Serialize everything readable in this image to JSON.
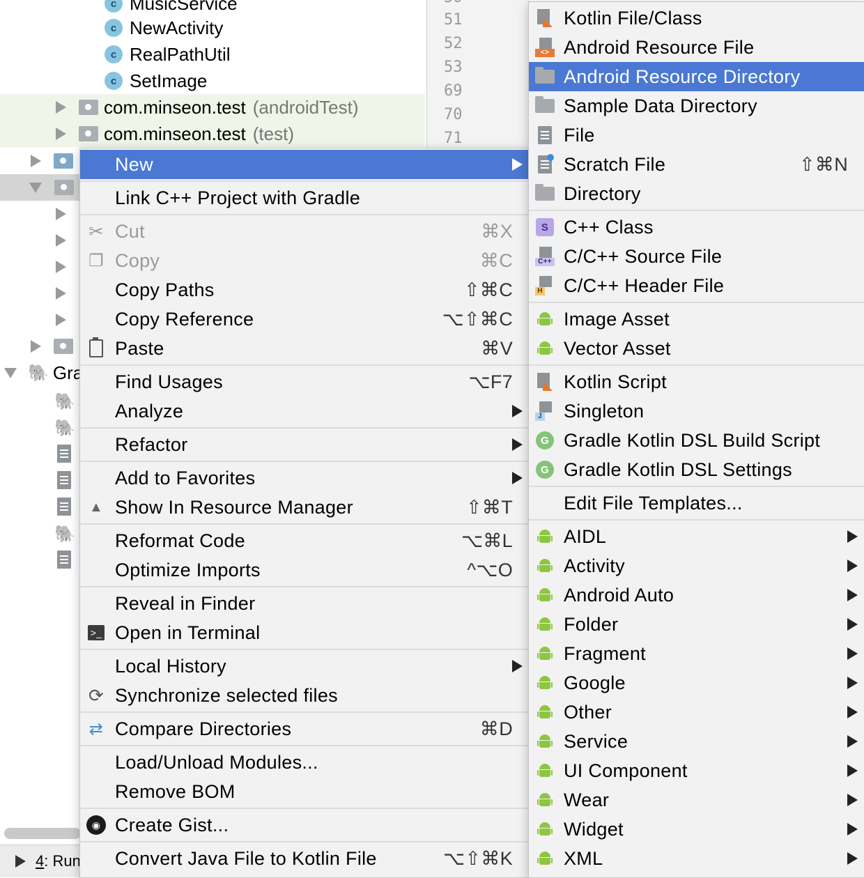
{
  "tree": {
    "classes": [
      "MusicService",
      "NewActivity",
      "RealPathUtil",
      "SetImage"
    ],
    "class_badge": "c",
    "packages": [
      {
        "name": "com.minseon.test",
        "suffix": "(androidTest)"
      },
      {
        "name": "com.minseon.test",
        "suffix": "(test)"
      }
    ],
    "gradle_label": "Gra"
  },
  "gutter": {
    "lines": [
      "51",
      "52",
      "53",
      "69",
      "70",
      "71"
    ]
  },
  "runbar": {
    "number": "4",
    "label": ": Run"
  },
  "context_menu": {
    "items": [
      {
        "name": "new",
        "label": "New",
        "shortcut": "",
        "submenu": true,
        "selected": true,
        "icon": ""
      },
      {
        "sep": true
      },
      {
        "name": "link-cpp",
        "label": "Link C++ Project with Gradle",
        "shortcut": "",
        "icon": ""
      },
      {
        "sep": true
      },
      {
        "name": "cut",
        "label": "Cut",
        "shortcut": "⌘X",
        "disabled": true,
        "icon": "scissors-icon"
      },
      {
        "name": "copy",
        "label": "Copy",
        "shortcut": "⌘C",
        "disabled": true,
        "icon": "copy-icon"
      },
      {
        "name": "copy-paths",
        "label": "Copy Paths",
        "shortcut": "⇧⌘C",
        "icon": ""
      },
      {
        "name": "copy-reference",
        "label": "Copy Reference",
        "shortcut": "⌥⇧⌘C",
        "icon": ""
      },
      {
        "name": "paste",
        "label": "Paste",
        "shortcut": "⌘V",
        "icon": "clipboard-icon"
      },
      {
        "sep": true
      },
      {
        "name": "find-usages",
        "label": "Find Usages",
        "shortcut": "⌥F7",
        "icon": ""
      },
      {
        "name": "analyze",
        "label": "Analyze",
        "submenu": true,
        "icon": ""
      },
      {
        "sep": true
      },
      {
        "name": "refactor",
        "label": "Refactor",
        "submenu": true,
        "icon": ""
      },
      {
        "sep": true
      },
      {
        "name": "add-favorites",
        "label": "Add to Favorites",
        "submenu": true,
        "icon": ""
      },
      {
        "name": "show-resource-manager",
        "label": "Show In Resource Manager",
        "shortcut": "⇧⌘T",
        "icon": "shapes-icon"
      },
      {
        "sep": true
      },
      {
        "name": "reformat",
        "label": "Reformat Code",
        "shortcut": "⌥⌘L",
        "icon": ""
      },
      {
        "name": "optimize-imports",
        "label": "Optimize Imports",
        "shortcut": "^⌥O",
        "icon": ""
      },
      {
        "sep": true
      },
      {
        "name": "reveal-finder",
        "label": "Reveal in Finder",
        "shortcut": "",
        "icon": ""
      },
      {
        "name": "open-terminal",
        "label": "Open in Terminal",
        "shortcut": "",
        "icon": "terminal-icon"
      },
      {
        "sep": true
      },
      {
        "name": "local-history",
        "label": "Local History",
        "submenu": true,
        "icon": ""
      },
      {
        "name": "synchronize",
        "label": "Synchronize selected files",
        "shortcut": "",
        "icon": "sync-icon"
      },
      {
        "sep": true
      },
      {
        "name": "compare-dirs",
        "label": "Compare Directories",
        "shortcut": "⌘D",
        "icon": "compare-icon"
      },
      {
        "sep": true
      },
      {
        "name": "load-unload",
        "label": "Load/Unload Modules...",
        "shortcut": "",
        "icon": ""
      },
      {
        "name": "remove-bom",
        "label": "Remove BOM",
        "shortcut": "",
        "icon": ""
      },
      {
        "sep": true
      },
      {
        "name": "create-gist",
        "label": "Create Gist...",
        "shortcut": "",
        "icon": "github-icon"
      },
      {
        "sep": true
      },
      {
        "name": "convert-kotlin",
        "label": "Convert Java File to Kotlin File",
        "shortcut": "⌥⇧⌘K",
        "icon": ""
      }
    ]
  },
  "new_submenu": {
    "items": [
      {
        "name": "kotlin-file",
        "label": "Kotlin File/Class",
        "icon": "kotlin-icon"
      },
      {
        "name": "android-resource-file",
        "label": "Android Resource File",
        "icon": "resource-file-icon"
      },
      {
        "name": "android-resource-dir",
        "label": "Android Resource Directory",
        "icon": "folder-icon",
        "selected": true
      },
      {
        "name": "sample-data-dir",
        "label": "Sample Data Directory",
        "icon": "folder-icon"
      },
      {
        "name": "file",
        "label": "File",
        "icon": "file-icon"
      },
      {
        "name": "scratch-file",
        "label": "Scratch File",
        "shortcut": "⇧⌘N",
        "icon": "scratch-icon"
      },
      {
        "name": "directory",
        "label": "Directory",
        "icon": "folder-icon"
      },
      {
        "sep": true
      },
      {
        "name": "cpp-class",
        "label": "C++ Class",
        "icon": "s-badge-icon",
        "badge": "S"
      },
      {
        "name": "cpp-source",
        "label": "C/C++ Source File",
        "icon": "cpp-icon",
        "badge": "C++"
      },
      {
        "name": "cpp-header",
        "label": "C/C++ Header File",
        "icon": "header-icon",
        "badge": "H"
      },
      {
        "sep": true
      },
      {
        "name": "image-asset",
        "label": "Image Asset",
        "icon": "android-icon"
      },
      {
        "name": "vector-asset",
        "label": "Vector Asset",
        "icon": "android-icon"
      },
      {
        "sep": true
      },
      {
        "name": "kotlin-script",
        "label": "Kotlin Script",
        "icon": "kotlin-icon"
      },
      {
        "name": "singleton",
        "label": "Singleton",
        "icon": "java-icon",
        "badge": "J"
      },
      {
        "name": "gradle-kts-build",
        "label": "Gradle Kotlin DSL Build Script",
        "icon": "g-badge-icon",
        "badge": "G"
      },
      {
        "name": "gradle-kts-settings",
        "label": "Gradle Kotlin DSL Settings",
        "icon": "g-badge-icon",
        "badge": "G"
      },
      {
        "sep": true
      },
      {
        "name": "edit-templates",
        "label": "Edit File Templates...",
        "icon": ""
      },
      {
        "sep": true
      },
      {
        "name": "aidl",
        "label": "AIDL",
        "icon": "android-icon",
        "submenu": true
      },
      {
        "name": "activity",
        "label": "Activity",
        "icon": "android-icon",
        "submenu": true
      },
      {
        "name": "android-auto",
        "label": "Android Auto",
        "icon": "android-icon",
        "submenu": true
      },
      {
        "name": "folder",
        "label": "Folder",
        "icon": "android-icon",
        "submenu": true
      },
      {
        "name": "fragment",
        "label": "Fragment",
        "icon": "android-icon",
        "submenu": true
      },
      {
        "name": "google",
        "label": "Google",
        "icon": "android-icon",
        "submenu": true
      },
      {
        "name": "other",
        "label": "Other",
        "icon": "android-icon",
        "submenu": true
      },
      {
        "name": "service",
        "label": "Service",
        "icon": "android-icon",
        "submenu": true
      },
      {
        "name": "ui-component",
        "label": "UI Component",
        "icon": "android-icon",
        "submenu": true
      },
      {
        "name": "wear",
        "label": "Wear",
        "icon": "android-icon",
        "submenu": true
      },
      {
        "name": "widget",
        "label": "Widget",
        "icon": "android-icon",
        "submenu": true
      },
      {
        "name": "xml",
        "label": "XML",
        "icon": "android-icon",
        "submenu": true
      }
    ]
  },
  "colors": {
    "selection": "#4a78d3",
    "menu_bg": "#f2f2f2",
    "android_green": "#8dc63f"
  }
}
